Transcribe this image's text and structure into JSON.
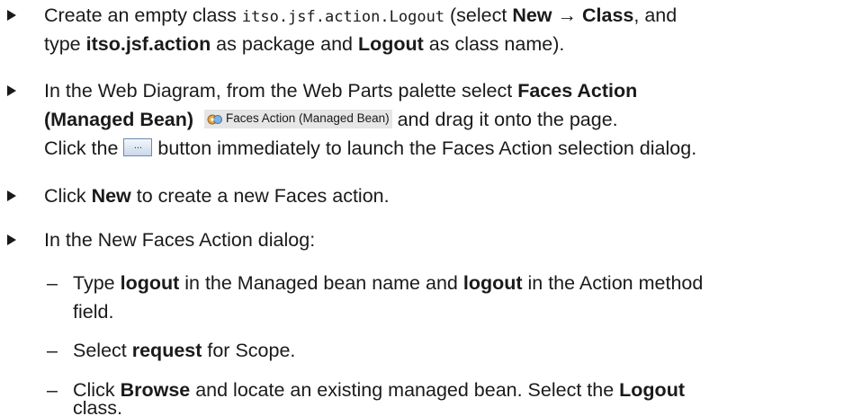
{
  "item1": {
    "line1_pre": "Create an empty class ",
    "code": "itso.jsf.action.Logout",
    "line1_post": " (select ",
    "new_bold": "New",
    "arrow": " → ",
    "class_bold": "Class",
    "line1_end": ", and",
    "line2_pre": "type ",
    "pkg_bold": "itso.jsf.action",
    "line2_mid": " as package and ",
    "logout_bold": "Logout",
    "line2_end": " as class name)."
  },
  "item2": {
    "line1_pre": "In the Web Diagram, from the Web Parts palette select ",
    "bold1": "Faces Action",
    "bold2": "(Managed Bean)",
    "chip_label": "Faces Action (Managed Bean)",
    "chip_icon": "faces-action-icon",
    "line2_post": " and drag it onto the page.",
    "line3_pre": "Click the ",
    "button_label": "...",
    "line3_post": " button immediately to launch the Faces Action selection dialog."
  },
  "item3": {
    "pre": "Click ",
    "bold": "New",
    "post": " to create a new Faces action."
  },
  "item4": {
    "text": "In the New Faces Action dialog:"
  },
  "sub1": {
    "pre": "Type ",
    "bold1": "logout",
    "mid": " in the Managed bean name and ",
    "bold2": "logout",
    "post": " in the Action method",
    "line2": "field."
  },
  "sub2": {
    "pre": "Select ",
    "bold": "request",
    "post": " for Scope."
  },
  "sub3": {
    "pre": "Click ",
    "bold1": "Browse",
    "mid": " and locate an existing managed bean. Select the ",
    "bold2": "Logout",
    "line2": "class."
  },
  "dash_char": "–"
}
